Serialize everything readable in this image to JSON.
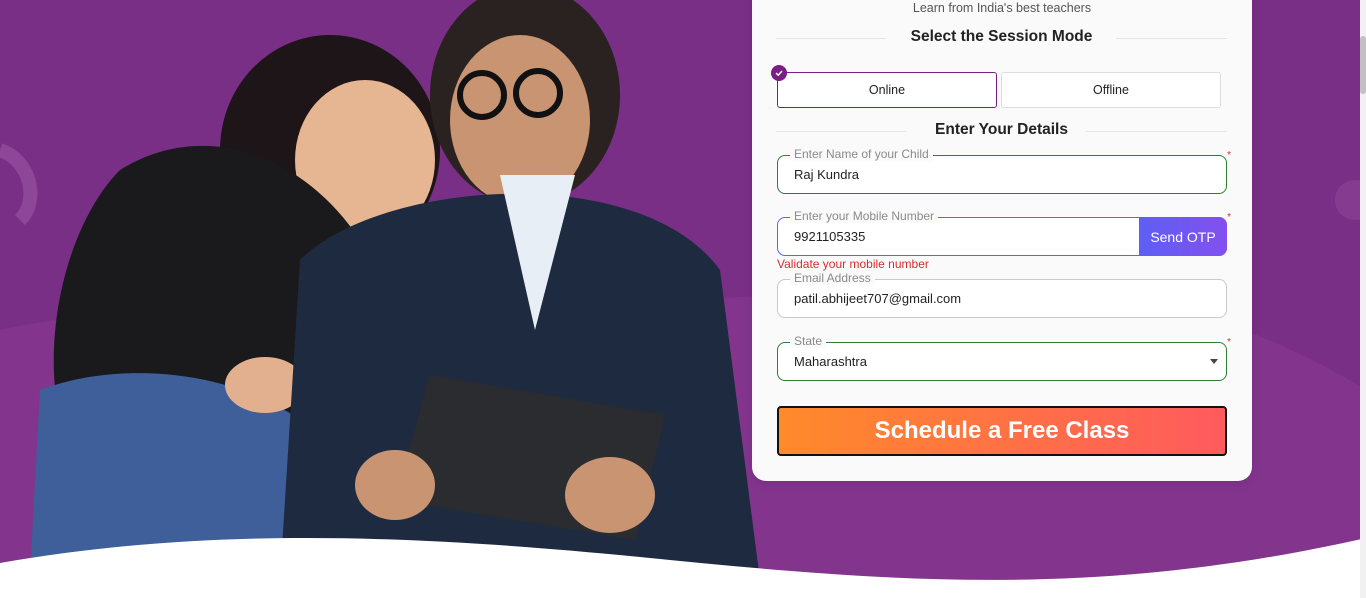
{
  "form": {
    "tagline": "Learn from India's best teachers",
    "session_mode_title": "Select the Session Mode",
    "modes": [
      {
        "label": "Online",
        "selected": true
      },
      {
        "label": "Offline",
        "selected": false
      }
    ],
    "details_title": "Enter Your Details",
    "child_name": {
      "label": "Enter Name of your Child",
      "value": "Raj Kundra",
      "required_mark": "*"
    },
    "mobile": {
      "label": "Enter your Mobile Number",
      "value": "9921105335",
      "required_mark": "*",
      "otp_label": "Send OTP",
      "error": "Validate your mobile number"
    },
    "email": {
      "label": "Email Address",
      "value": "patil.abhijeet707@gmail.com"
    },
    "state": {
      "label": "State",
      "value": "Maharashtra",
      "required_mark": "*"
    },
    "submit_label": "Schedule a Free Class"
  },
  "colors": {
    "hero_bg": "#7a2f86",
    "accent": "#7b1c87",
    "success_border": "#2e7d32",
    "focus_border": "#5b63f2",
    "error": "#d32f2f",
    "cta_start": "#ff8a2a",
    "cta_end": "#ff5a5e"
  },
  "hero": {
    "image": "adult-and-child-with-tablet"
  }
}
